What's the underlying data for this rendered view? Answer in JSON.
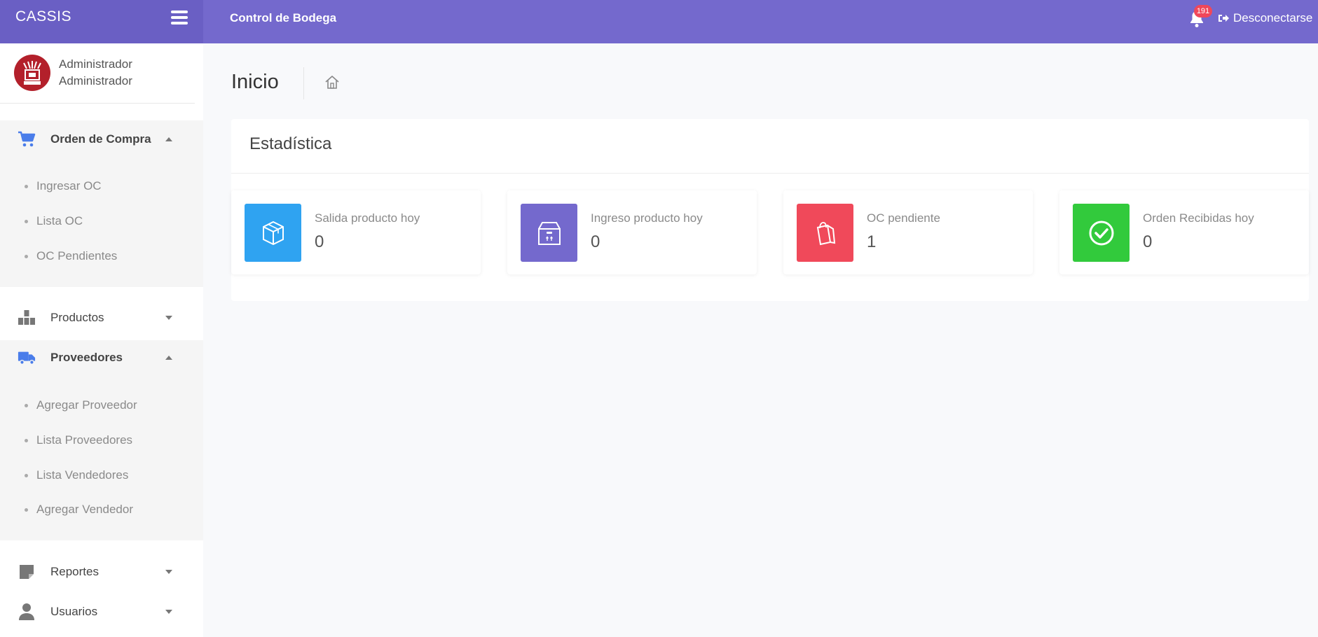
{
  "topbar": {
    "brand": "CASSIS",
    "title": "Control de Bodega",
    "notifications_count": "191",
    "logout_label": "Desconectarse",
    "color": "#7469cd"
  },
  "sidebar": {
    "user": {
      "line1": "Administrador",
      "line2": "Administrador"
    },
    "menus": [
      {
        "label": "Orden de Compra",
        "icon": "cart-icon",
        "expanded": true,
        "items": [
          "Ingresar OC",
          "Lista OC",
          "OC Pendientes"
        ]
      },
      {
        "label": "Productos",
        "icon": "boxes-icon",
        "expanded": false
      },
      {
        "label": "Proveedores",
        "icon": "truck-icon",
        "expanded": true,
        "items": [
          "Agregar Proveedor",
          "Lista Proveedores",
          "Lista Vendedores",
          "Agregar Vendedor"
        ]
      },
      {
        "label": "Reportes",
        "icon": "note-icon",
        "expanded": false
      },
      {
        "label": "Usuarios",
        "icon": "user-icon",
        "expanded": false
      }
    ]
  },
  "main": {
    "page_title": "Inicio",
    "card_title": "Estadística",
    "stats": [
      {
        "label": "Salida producto hoy",
        "value": "0",
        "color": "#2fa3f1",
        "icon": "box-3d-icon"
      },
      {
        "label": "Ingreso producto hoy",
        "value": "0",
        "color": "#7469cd",
        "icon": "package-icon"
      },
      {
        "label": "OC pendiente",
        "value": "1",
        "color": "#f0495a",
        "icon": "shopping-bag-icon"
      },
      {
        "label": "Orden Recibidas hoy",
        "value": "0",
        "color": "#32ca3c",
        "icon": "check-circle-icon"
      }
    ]
  }
}
